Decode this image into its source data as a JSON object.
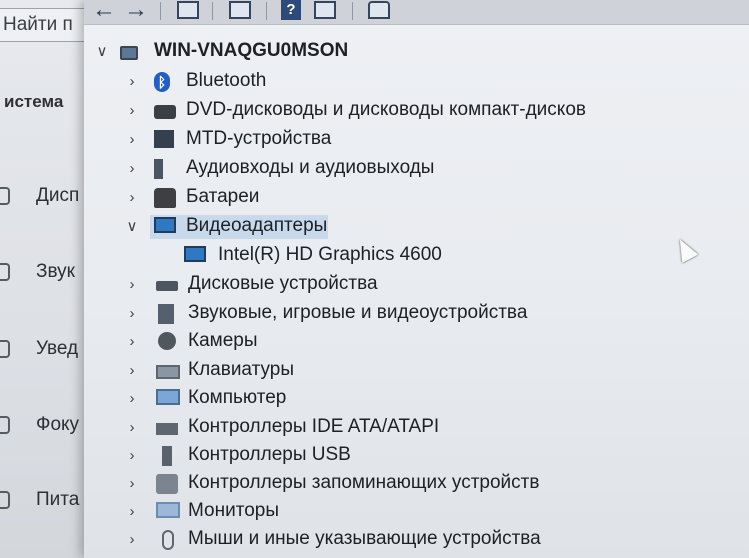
{
  "settings": {
    "search_placeholder": "Найти п",
    "section_title": "истема",
    "items": [
      {
        "label": "Дисп",
        "icon": "display-icon"
      },
      {
        "label": "Звук",
        "icon": "sound-icon"
      },
      {
        "label": "Увед",
        "icon": "notifications-icon"
      },
      {
        "label": "Фоку",
        "icon": "focus-icon"
      },
      {
        "label": "Пита",
        "icon": "power-icon"
      }
    ]
  },
  "device_manager": {
    "computer_name": "WIN-VNAQGU0MSON",
    "categories": [
      {
        "label": "Bluetooth",
        "icon": "bluetooth-icon",
        "expanded": false
      },
      {
        "label": "DVD-дисководы и дисководы компакт-дисков",
        "icon": "dvd-drive-icon",
        "expanded": false
      },
      {
        "label": "MTD-устройства",
        "icon": "mtd-device-icon",
        "expanded": false
      },
      {
        "label": "Аудиовходы и аудиовыходы",
        "icon": "audio-io-icon",
        "expanded": false
      },
      {
        "label": "Батареи",
        "icon": "battery-icon",
        "expanded": false
      },
      {
        "label": "Видеоадаптеры",
        "icon": "display-adapter-icon",
        "expanded": true,
        "selected": true,
        "children": [
          {
            "label": "Intel(R) HD Graphics 4600",
            "icon": "display-adapter-icon"
          }
        ]
      },
      {
        "label": "Дисковые устройства",
        "icon": "disk-drive-icon",
        "expanded": false
      },
      {
        "label": "Звуковые, игровые и видеоустройства",
        "icon": "speaker-icon",
        "expanded": false
      },
      {
        "label": "Камеры",
        "icon": "camera-icon",
        "expanded": false
      },
      {
        "label": "Клавиатуры",
        "icon": "keyboard-icon",
        "expanded": false
      },
      {
        "label": "Компьютер",
        "icon": "computer-icon",
        "expanded": false
      },
      {
        "label": "Контроллеры IDE ATA/ATAPI",
        "icon": "ide-controller-icon",
        "expanded": false
      },
      {
        "label": "Контроллеры USB",
        "icon": "usb-icon",
        "expanded": false
      },
      {
        "label": "Контроллеры запоминающих устройств",
        "icon": "storage-controller-icon",
        "expanded": false
      },
      {
        "label": "Мониторы",
        "icon": "monitor-icon",
        "expanded": false
      },
      {
        "label": "Мыши и иные указывающие устройства",
        "icon": "mouse-icon",
        "expanded": false
      }
    ]
  },
  "toolbar": {
    "help_label": "?",
    "buttons": [
      "back-icon",
      "forward-icon",
      "properties-icon",
      "update-driver-icon",
      "help-icon",
      "show-hidden-icon",
      "scan-hardware-icon"
    ]
  }
}
